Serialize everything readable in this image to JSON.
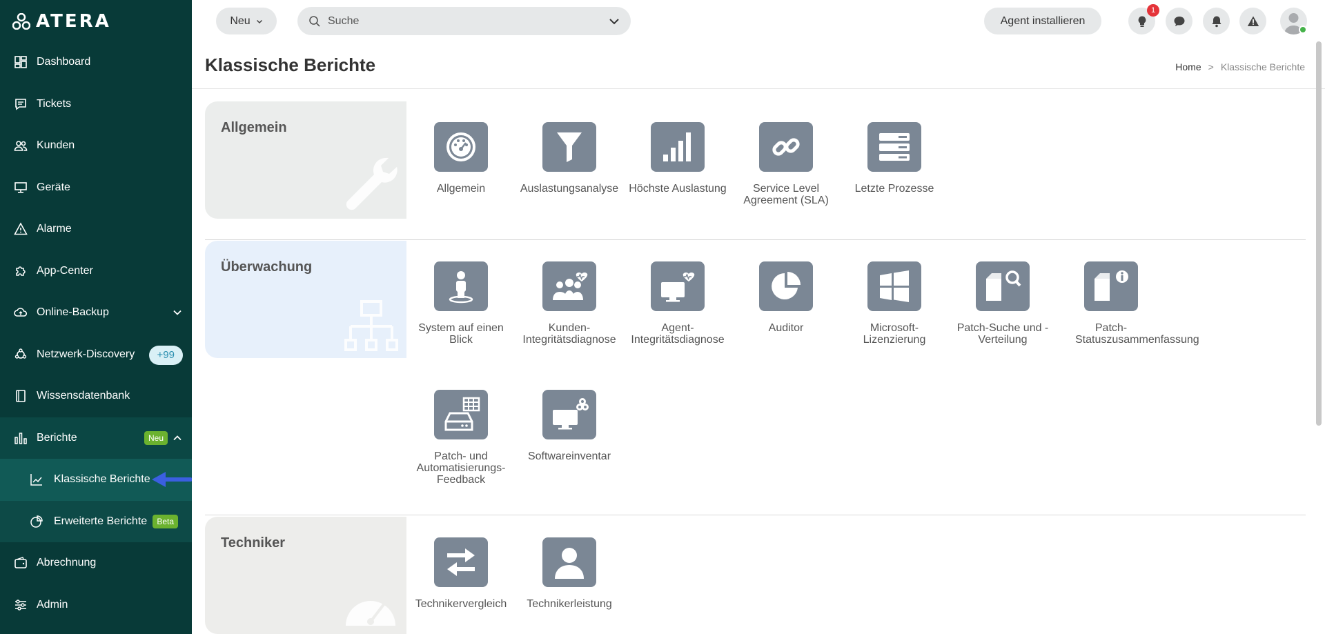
{
  "brand": {
    "logo_text": "ATERA"
  },
  "sidebar": {
    "items": [
      {
        "label": "Dashboard",
        "icon": "dashboard-icon"
      },
      {
        "label": "Tickets",
        "icon": "tickets-icon"
      },
      {
        "label": "Kunden",
        "icon": "customers-icon"
      },
      {
        "label": "Geräte",
        "icon": "devices-icon"
      },
      {
        "label": "Alarme",
        "icon": "alerts-icon"
      },
      {
        "label": "App-Center",
        "icon": "puzzle-icon"
      },
      {
        "label": "Online-Backup",
        "icon": "cloud-icon"
      },
      {
        "label": "Netzwerk-Discovery",
        "icon": "network-icon",
        "badge": "+99"
      },
      {
        "label": "Wissensdatenbank",
        "icon": "book-icon"
      },
      {
        "label": "Berichte",
        "icon": "bar-chart-icon",
        "badge": "Neu"
      },
      {
        "label": "Abrechnung",
        "icon": "wallet-icon"
      },
      {
        "label": "Admin",
        "icon": "sliders-icon"
      }
    ],
    "sub_items": [
      {
        "label": "Klassische Berichte",
        "icon": "line-chart-icon"
      },
      {
        "label": "Erweiterte Berichte",
        "icon": "pie-chart-icon",
        "badge": "Beta"
      }
    ]
  },
  "topbar": {
    "new_label": "Neu",
    "search_placeholder": "Suche",
    "install_agent_label": "Agent installieren",
    "notification_count": "1"
  },
  "page": {
    "title": "Klassische Berichte",
    "breadcrumb_home": "Home",
    "breadcrumb_sep": ">",
    "breadcrumb_current": "Klassische Berichte"
  },
  "sections": [
    {
      "title": "Allgemein",
      "reports": [
        "Allgemein",
        "Auslastungsanalyse",
        "Höchste Auslastung",
        "Service Level Agreement (SLA)",
        "Letzte Prozesse"
      ]
    },
    {
      "title": "Überwachung",
      "reports": [
        "System auf einen Blick",
        "Kunden-Integritätsdiagnose",
        "Agent-Integritätsdiagnose",
        "Auditor",
        "Microsoft-Lizenzierung",
        "Patch-Suche und -Verteilung",
        "Patch-Statuszusammenfassung",
        "Patch- und Automatisierungs-Feedback",
        "Softwareinventar"
      ]
    },
    {
      "title": "Techniker",
      "reports": [
        "Technikervergleich",
        "Technikerleistung"
      ]
    }
  ],
  "colors": {
    "sidebar": "#083a38",
    "tile": "#7b8795",
    "badge_green": "#6bb22f",
    "accent_arrow": "#3b5fe0"
  }
}
